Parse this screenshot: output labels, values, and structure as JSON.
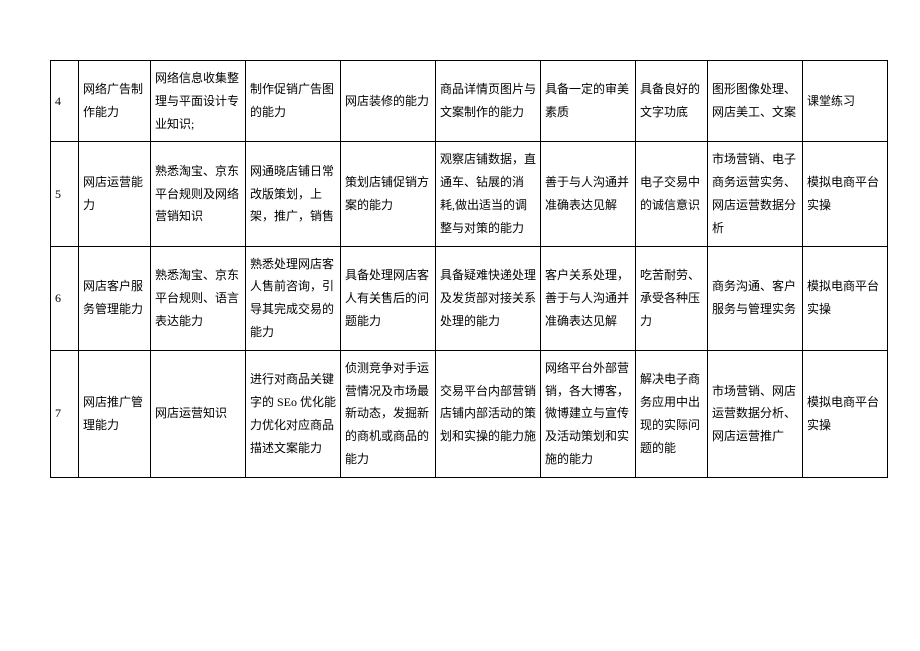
{
  "rows": [
    {
      "num": "4",
      "ability": "网络广告制作能力",
      "knowledge": "网络信息收集整理与平面设计专业知识;",
      "skill1": "制作促销广告图的能力",
      "skill2": "网店装修的能力",
      "skill3": "商品详情页图片与文案制作的能力",
      "quality1": "具备一定的审美素质",
      "quality2": "具备良好的文字功底",
      "course": "图形图像处理、网店美工、文案",
      "method": "课堂练习"
    },
    {
      "num": "5",
      "ability": "网店运营能力",
      "knowledge": "熟悉淘宝、京东平台规则及网络营销知识",
      "skill1": "网通晓店铺日常改版策划，上架，推广，销售",
      "skill2": "策划店铺促销方案的能力",
      "skill3": "观察店铺数据，直通车、钻展的消耗,做出适当的调整与对策的能力",
      "quality1": "善于与人沟通并准确表达见解",
      "quality2": "电子交易中的诚信意识",
      "course": "市场营销、电子商务运营实务、网店运营数据分析",
      "method": "模拟电商平台实操"
    },
    {
      "num": "6",
      "ability": "网店客户服务管理能力",
      "knowledge": "熟悉淘宝、京东平台规则、语言表达能力",
      "skill1": "熟悉处理网店客人售前咨询，引导其完成交易的能力",
      "skill2": "具备处理网店客人有关售后的问题能力",
      "skill3": "具备疑难快递处理及发货部对接关系处理的能力",
      "quality1": "客户关系处理，善于与人沟通并准确表达见解",
      "quality2": "吃苦耐劳、承受各种压力",
      "course": "商务沟通、客户服务与管理实务",
      "method": "模拟电商平台实操"
    },
    {
      "num": "7",
      "ability": "网店推广管理能力",
      "knowledge": "网店运营知识",
      "skill1": "进行对商品关键字的 SEo 优化能力优化对应商品描述文案能力",
      "skill2": "侦测竞争对手运营情况及市场最新动态，发掘新的商机或商品的能力",
      "skill3": "交易平台内部营销店铺内部活动的策划和实操的能力施",
      "quality1": "网络平台外部营销，各大博客，微博建立与宣传及活动策划和实施的能力",
      "quality2": "解决电子商务应用中出现的实际问题的能",
      "course": "市场营销、网店运营数据分析、网店运营推广",
      "method": "模拟电商平台实操"
    }
  ]
}
